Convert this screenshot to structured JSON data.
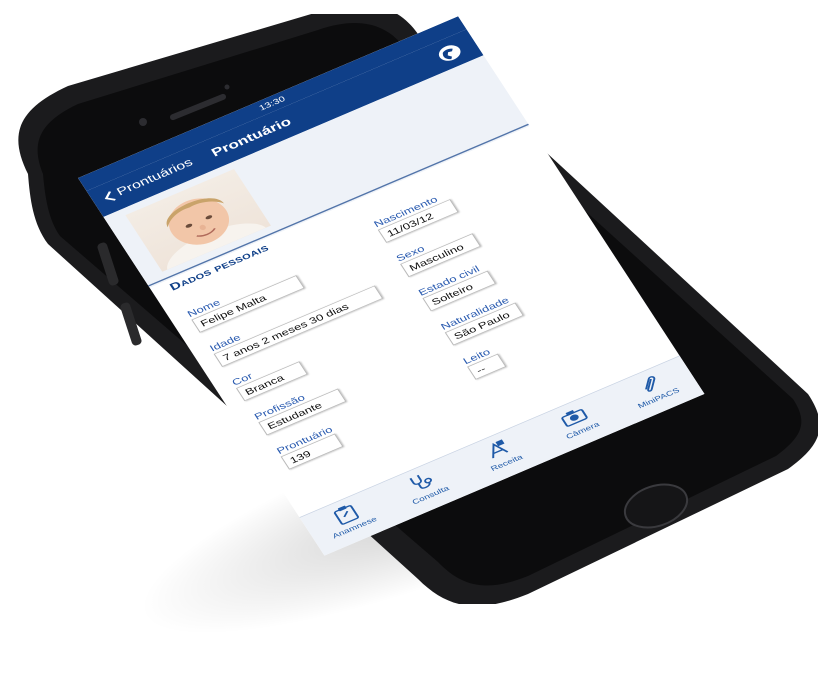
{
  "status_bar": {
    "time": "13:30"
  },
  "nav": {
    "back_label": "Prontuários",
    "title": "Prontuário"
  },
  "section_title": "Dados pessoais",
  "fields": {
    "nome": {
      "label": "Nome",
      "value": "Felipe Malta"
    },
    "nascimento": {
      "label": "Nascimento",
      "value": "11/03/12"
    },
    "sexo": {
      "label": "Sexo",
      "value": "Masculino"
    },
    "idade": {
      "label": "Idade",
      "value": "7 anos 2 meses 30 dias"
    },
    "estado_civil": {
      "label": "Estado civil",
      "value": "Solteiro"
    },
    "cor": {
      "label": "Cor",
      "value": "Branca"
    },
    "naturalidade": {
      "label": "Naturalidade",
      "value": "São Paulo"
    },
    "profissao": {
      "label": "Profissão",
      "value": "Estudante"
    },
    "leito": {
      "label": "Leito",
      "value": "--"
    },
    "prontuario": {
      "label": "Prontuário",
      "value": "139"
    }
  },
  "tabs": [
    {
      "label": "Anamnese",
      "icon": "clipboard-icon"
    },
    {
      "label": "Consulta",
      "icon": "stethoscope-icon"
    },
    {
      "label": "Receita",
      "icon": "prescription-icon"
    },
    {
      "label": "Câmera",
      "icon": "camera-icon"
    },
    {
      "label": "MiniPACS",
      "icon": "paperclip-icon"
    }
  ],
  "colors": {
    "primary": "#0f3f88",
    "accent": "#2a5bb0",
    "background": "#eef2f8"
  }
}
